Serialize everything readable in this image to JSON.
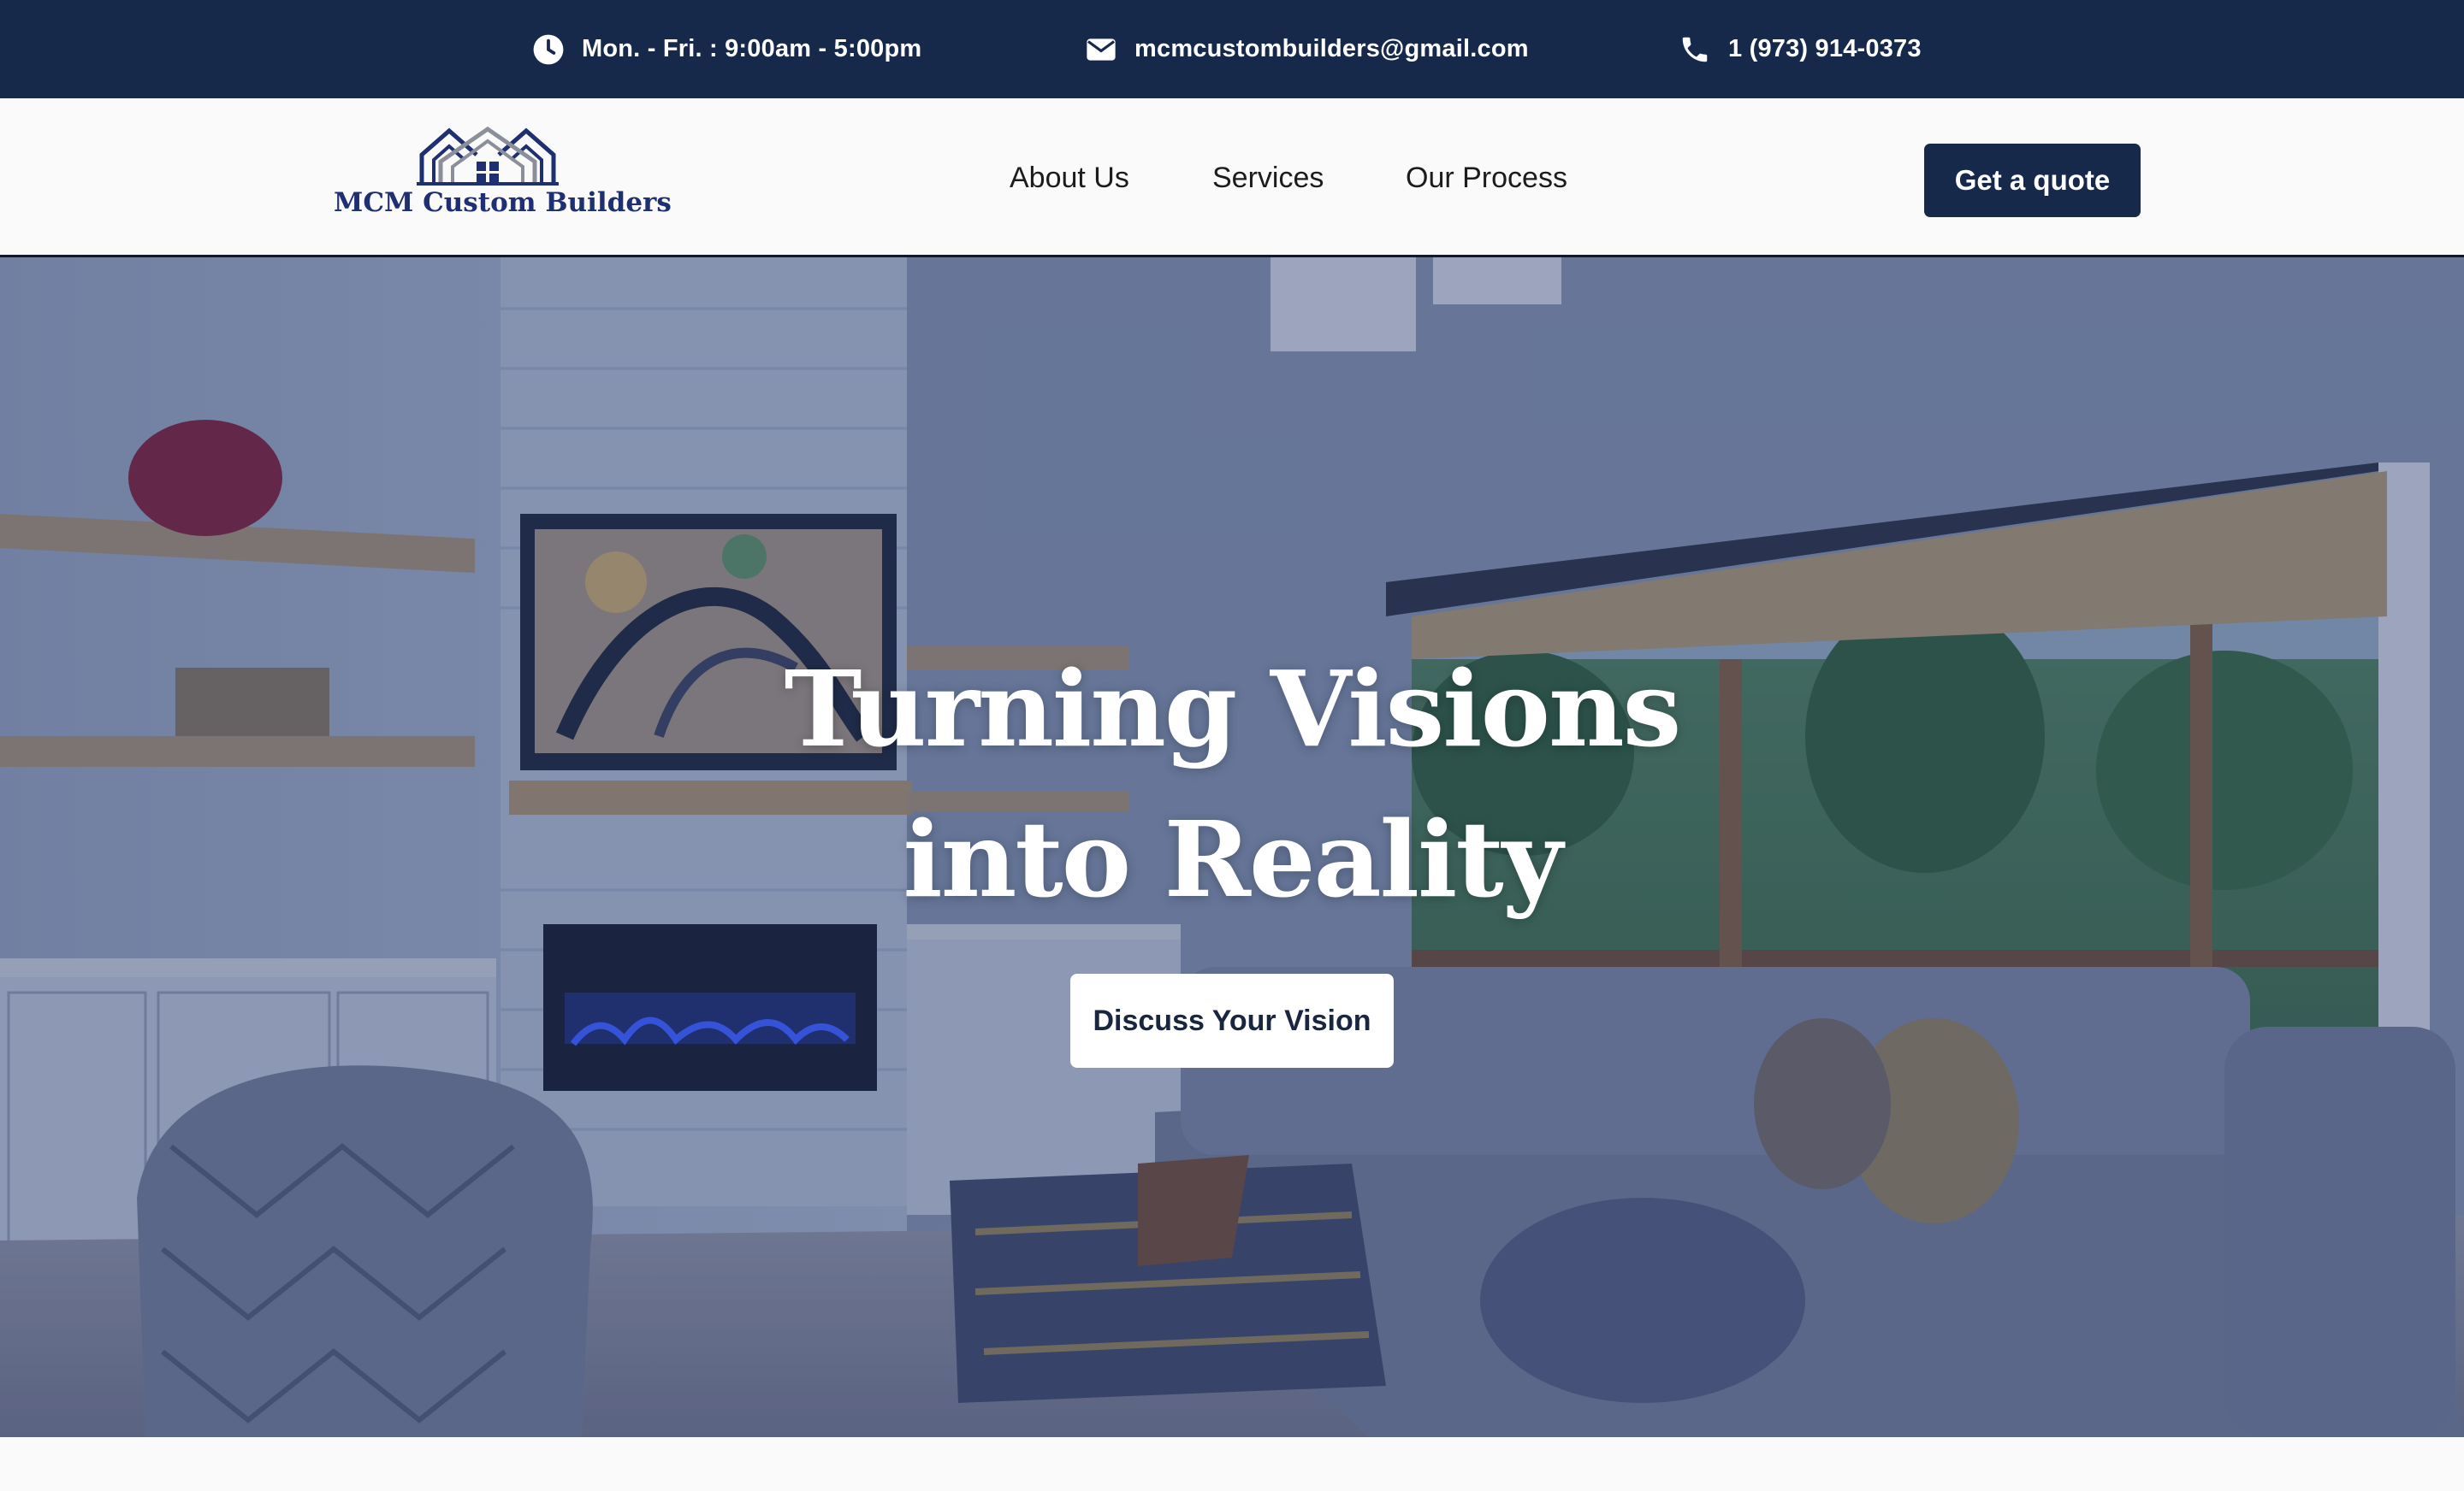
{
  "topbar": {
    "hours": "Mon. - Fri. : 9:00am - 5:00pm",
    "email": "mcmcustombuilders@gmail.com",
    "phone": "1 (973) 914-0373",
    "icons": {
      "hours": "clock-icon",
      "email": "envelope-icon",
      "phone": "phone-icon"
    },
    "background": "#16294b"
  },
  "nav": {
    "logo_text": "MCM Custom Builders",
    "links": [
      "About Us",
      "Services",
      "Our Process"
    ],
    "cta_label": "Get a quote"
  },
  "hero": {
    "title_line1": "Turning Visions",
    "title_line2": "into Reality",
    "button_label": "Discuss Your Vision"
  },
  "colors": {
    "brand_navy": "#16294b",
    "logo_blue": "#1e2f72",
    "white": "#ffffff"
  }
}
